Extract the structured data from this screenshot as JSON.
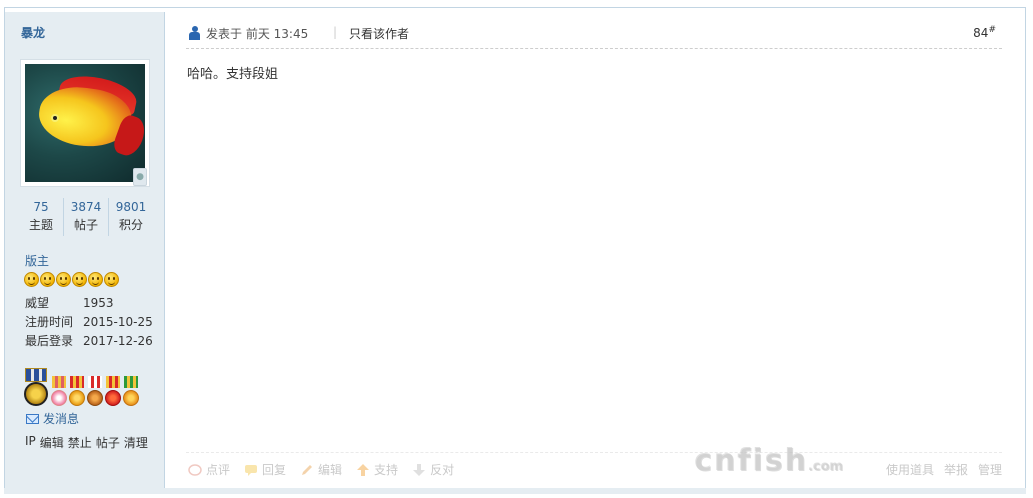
{
  "user": {
    "name": "暴龙",
    "stats": [
      {
        "value": "75",
        "label": "主题"
      },
      {
        "value": "3874",
        "label": "帖子"
      },
      {
        "value": "9801",
        "label": "积分"
      }
    ],
    "group": "版主",
    "info": [
      {
        "key": "威望",
        "value": "1953"
      },
      {
        "key": "注册时间",
        "value": "2015-10-25"
      },
      {
        "key": "最后登录",
        "value": "2017-12-26"
      }
    ],
    "send_message": "发消息",
    "admin_links": [
      "IP",
      "编辑",
      "禁止",
      "帖子",
      "清理"
    ]
  },
  "post": {
    "posted_at": "发表于 前天 13:45",
    "separator": "|",
    "only_author": "只看该作者",
    "floor": "84",
    "floor_mark": "#",
    "content": "哈哈。支持段姐",
    "actions": [
      "点评",
      "回复",
      "编辑",
      "支持",
      "反对"
    ],
    "right_actions": [
      "使用道具",
      "举报",
      "管理"
    ]
  },
  "watermark": {
    "main": "cnfish",
    "suffix": ".com"
  }
}
